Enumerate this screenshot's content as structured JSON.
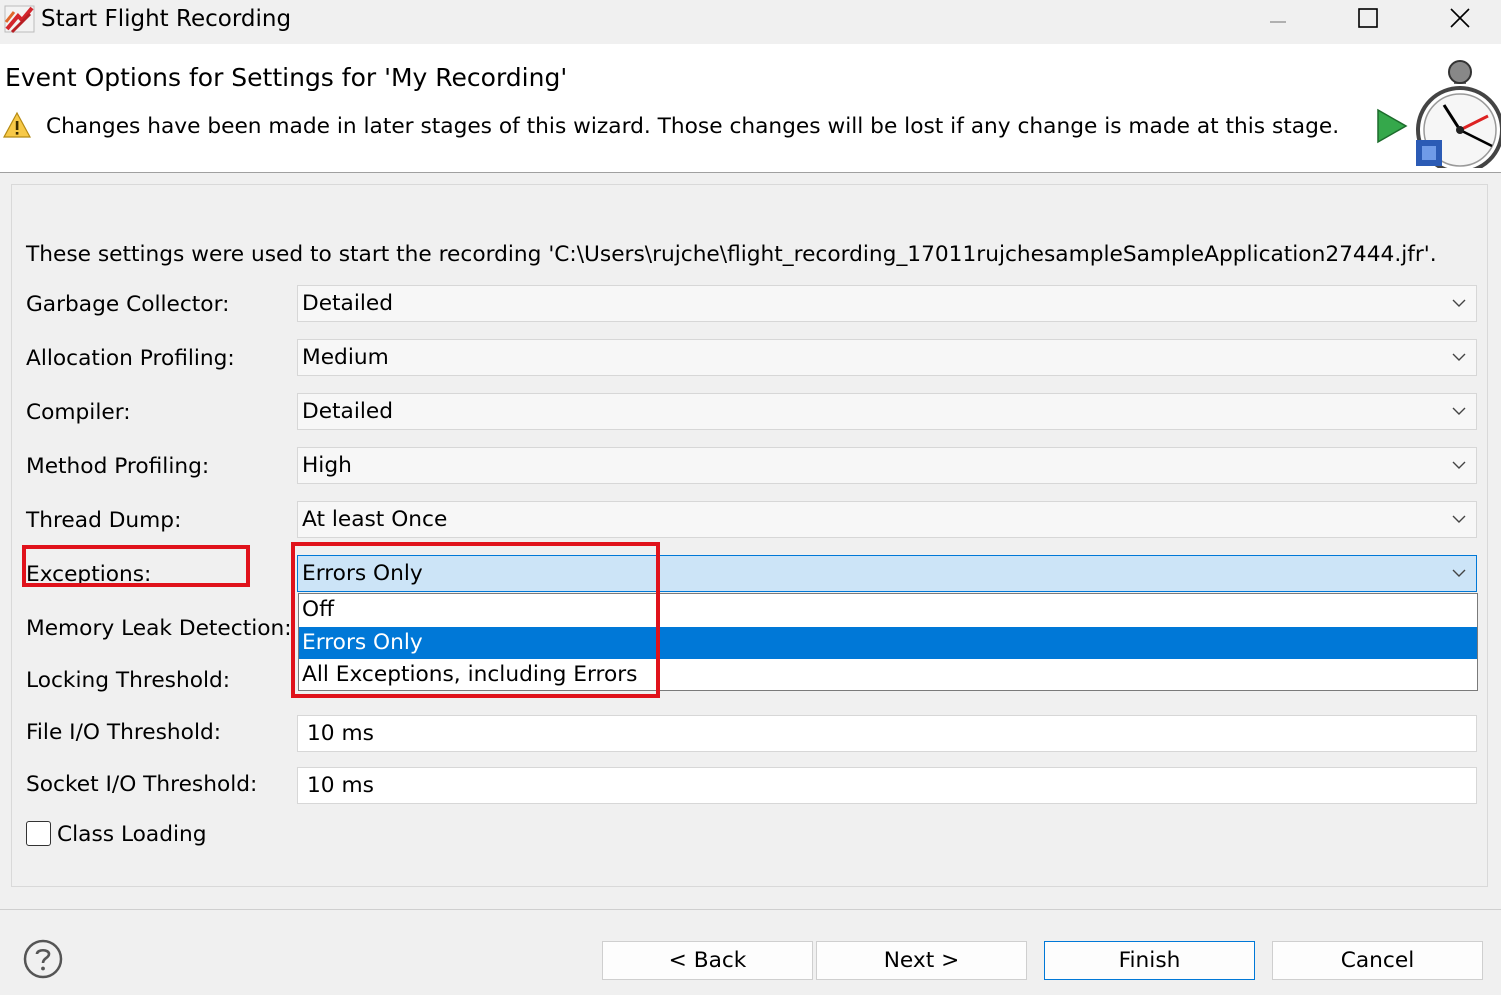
{
  "window": {
    "title": "Start Flight Recording",
    "controls": {
      "minimize": "minimize-icon",
      "maximize": "maximize-icon",
      "close": "close-icon"
    }
  },
  "header": {
    "title": "Event Options for Settings for 'My Recording'",
    "warning": "Changes have been made in later stages of this wizard. Those changes will be lost if any change is made at this stage.",
    "banner_icon": "flight-recorder-stopwatch-icon"
  },
  "content": {
    "intro": "These settings were used to start the recording 'C:\\Users\\rujche\\flight_recording_17011rujchesampleSampleApplication27444.jfr'.",
    "fields": [
      {
        "label": "Garbage Collector:",
        "value": "Detailed"
      },
      {
        "label": "Allocation Profiling:",
        "value": "Medium"
      },
      {
        "label": "Compiler:",
        "value": "Detailed"
      },
      {
        "label": "Method Profiling:",
        "value": "High"
      },
      {
        "label": "Thread Dump:",
        "value": "At least Once"
      },
      {
        "label": "Exceptions:",
        "value": "Errors Only"
      },
      {
        "label": "Memory Leak Detection:",
        "value": ""
      },
      {
        "label": "Locking Threshold:",
        "value": ""
      },
      {
        "label": "File I/O Threshold:",
        "value": "10 ms"
      },
      {
        "label": "Socket I/O Threshold:",
        "value": "10 ms"
      }
    ],
    "dropdown": {
      "options": [
        "Off",
        "Errors Only",
        "All Exceptions, including Errors"
      ],
      "selected": "Errors Only"
    },
    "class_loading": {
      "label": "Class Loading",
      "checked": false
    }
  },
  "buttons": {
    "back": "< Back",
    "next": "Next >",
    "finish": "Finish",
    "cancel": "Cancel",
    "help_icon": "help-icon"
  },
  "colors": {
    "accent": "#0078d7",
    "highlight_box": "#e0121b",
    "combo_focus": "#cce4f7"
  }
}
